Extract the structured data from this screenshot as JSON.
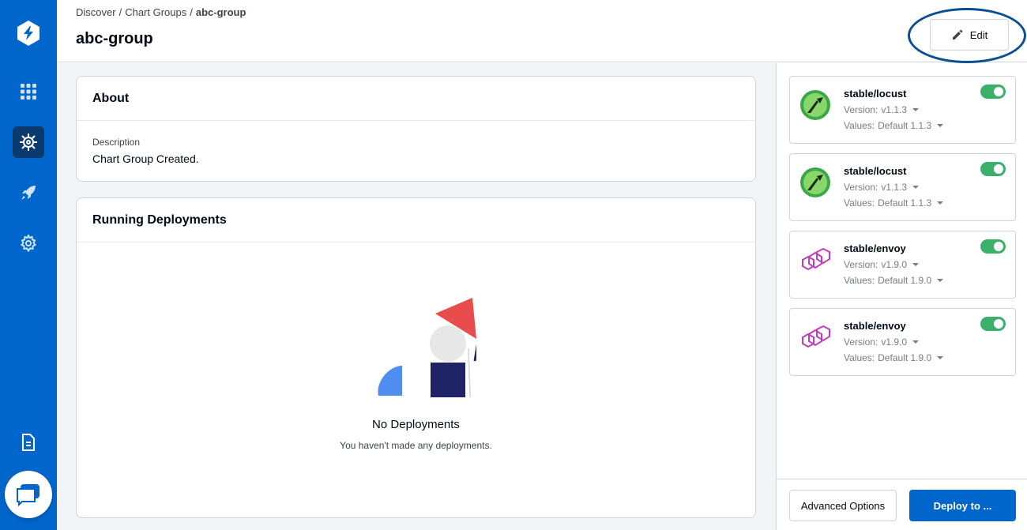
{
  "sidebar": {
    "logo": "devtron-logo-icon",
    "items": [
      {
        "name": "apps-grid-icon",
        "active": false
      },
      {
        "name": "charts-helm-icon",
        "active": true
      },
      {
        "name": "deploy-rocket-icon",
        "active": false
      },
      {
        "name": "settings-gear-icon",
        "active": false
      },
      {
        "name": "docs-icon",
        "active": false
      }
    ],
    "chat": "chat-bubble-icon"
  },
  "header": {
    "breadcrumb": [
      "Discover",
      "Chart Groups",
      "abc-group"
    ],
    "breadcrumb_sep": "/",
    "title": "abc-group",
    "edit_label": "Edit"
  },
  "about": {
    "title": "About",
    "description_label": "Description",
    "description_value": "Chart Group Created."
  },
  "deployments": {
    "title": "Running Deployments",
    "empty_title": "No Deployments",
    "empty_subtitle": "You haven't made any deployments."
  },
  "charts": [
    {
      "name": "stable/locust",
      "version_label": "Version:",
      "version": "v1.1.3",
      "values_label": "Values:",
      "values": "Default 1.1.3",
      "enabled": true,
      "icon": "locust-icon"
    },
    {
      "name": "stable/locust",
      "version_label": "Version:",
      "version": "v1.1.3",
      "values_label": "Values:",
      "values": "Default 1.1.3",
      "enabled": true,
      "icon": "locust-icon"
    },
    {
      "name": "stable/envoy",
      "version_label": "Version:",
      "version": "v1.9.0",
      "values_label": "Values:",
      "values": "Default 1.9.0",
      "enabled": true,
      "icon": "envoy-icon"
    },
    {
      "name": "stable/envoy",
      "version_label": "Version:",
      "version": "v1.9.0",
      "values_label": "Values:",
      "values": "Default 1.9.0",
      "enabled": true,
      "icon": "envoy-icon"
    }
  ],
  "footer": {
    "advanced_label": "Advanced Options",
    "deploy_label": "Deploy to ..."
  },
  "colors": {
    "sidebar": "#0066cc",
    "sidebar_active": "#0a3a6e",
    "primary": "#0066cc",
    "toggle_on": "#3ab06a",
    "highlight_ring": "#0b4e96"
  }
}
